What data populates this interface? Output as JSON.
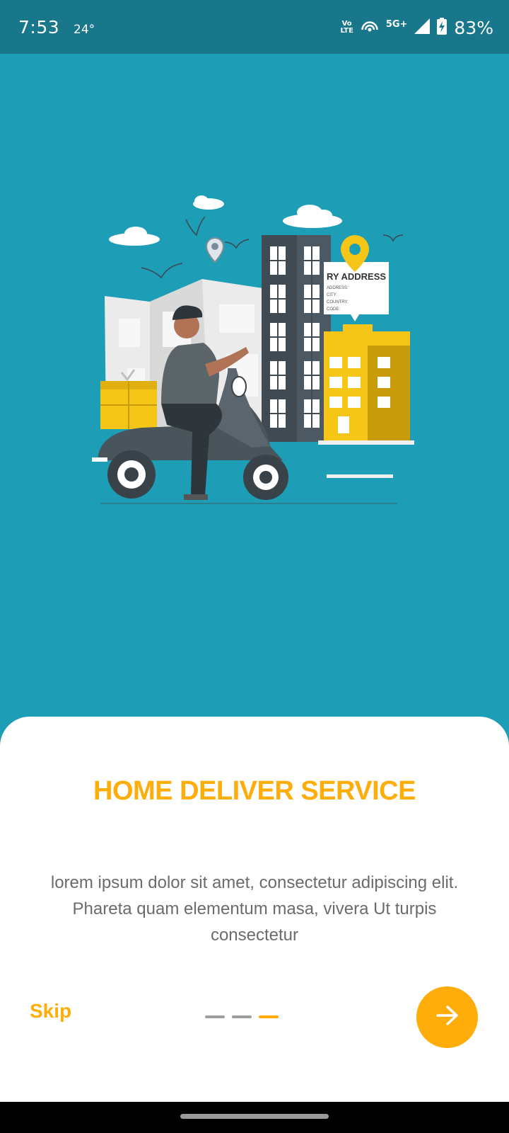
{
  "status_bar": {
    "time": "7:53",
    "temperature": "24°",
    "volte_line1": "Vo",
    "volte_line2": "LTE",
    "network": "5G+",
    "battery": "83%"
  },
  "illustration": {
    "address_card_title": "RY ADDRESS",
    "address_card_lines": [
      "ADDRESS:",
      "CITY:",
      "COUNTRY:",
      "CODE:"
    ]
  },
  "onboarding": {
    "title": "HOME DELIVER SERVICE",
    "description": "lorem ipsum dolor sit amet, consectetur adipiscing elit. Phareta quam elementum masa, vivera Ut turpis consectetur",
    "skip_label": "Skip",
    "page_count": 3,
    "current_page": 3
  },
  "colors": {
    "accent": "#ffad0a",
    "background": "#1e9db6",
    "status_bar": "#19778c",
    "body_text": "#6b6b6b"
  },
  "icons": {
    "next": "arrow-right-icon",
    "wifi": "hotspot-icon",
    "signal": "signal-icon",
    "battery": "battery-charging-icon"
  }
}
